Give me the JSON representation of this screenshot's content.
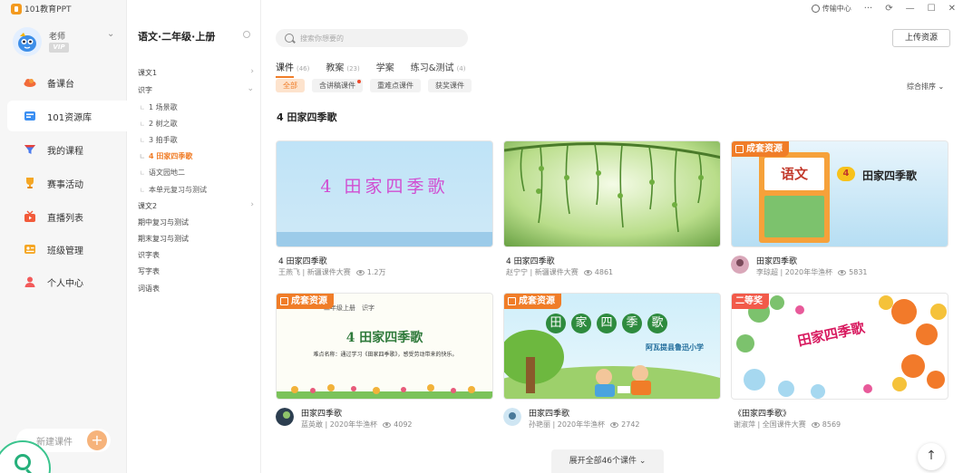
{
  "app": {
    "brand": "101教育PPT"
  },
  "titlebar": {
    "transfer": "传输中心",
    "more": "···",
    "sync": "⟳",
    "minimize": "—",
    "maximize": "☐",
    "close": "✕"
  },
  "user": {
    "name": "老师",
    "vip": "VIP",
    "chevron": "⌄"
  },
  "nav": {
    "items": [
      {
        "label": "备课台",
        "icon": "cloud-icon",
        "color": "#f26b3a"
      },
      {
        "label": "101资源库",
        "icon": "library-icon",
        "color": "#3a8ef2"
      },
      {
        "label": "我的课程",
        "icon": "funnel-icon",
        "color": "#4a7bef"
      },
      {
        "label": "赛事活动",
        "icon": "trophy-icon",
        "color": "#f5a623"
      },
      {
        "label": "直播列表",
        "icon": "live-tv-icon",
        "color": "#f25a3a"
      },
      {
        "label": "班级管理",
        "icon": "class-icon",
        "color": "#f5a623"
      },
      {
        "label": "个人中心",
        "icon": "person-icon",
        "color": "#f25a5a"
      }
    ],
    "new_course": "新建课件",
    "plus": "+"
  },
  "tree": {
    "book_title": "语文·二年级·上册",
    "rows": [
      {
        "label": "课文1",
        "chevron": "›"
      },
      {
        "label": "识字",
        "chevron": "⌄"
      },
      {
        "label": "1 场景歌",
        "bullet": "∟"
      },
      {
        "label": "2 树之歌",
        "bullet": "∟"
      },
      {
        "label": "3 拍手歌",
        "bullet": "∟"
      },
      {
        "label": "4 田家四季歌",
        "bullet": "∟"
      },
      {
        "label": "语文园地二",
        "bullet": "∟"
      },
      {
        "label": "本单元复习与测试",
        "bullet": "∟"
      },
      {
        "label": "课文2",
        "chevron": "›"
      },
      {
        "label": "期中复习与测试"
      },
      {
        "label": "期末复习与测试"
      },
      {
        "label": "识字表"
      },
      {
        "label": "写字表"
      },
      {
        "label": "词语表"
      }
    ]
  },
  "main": {
    "search_placeholder": "搜索你想要的",
    "upload": "上传资源",
    "tabs": [
      {
        "label": "课件",
        "count": "(46)"
      },
      {
        "label": "教案",
        "count": "(23)"
      },
      {
        "label": "学案",
        "count": ""
      },
      {
        "label": "练习&测试",
        "count": "(4)"
      }
    ],
    "chips": [
      "全部",
      "含讲稿课件",
      "重难点课件",
      "获奖课件"
    ],
    "sort": "综合排序 ⌄",
    "section_title": "4 田家四季歌",
    "expand": "展开全部46个课件 ⌄",
    "back_top": "↑"
  },
  "cards": [
    {
      "title": "4 田家四季歌",
      "meta": "王燕飞 | 新疆课件大赛",
      "views": "1.2万"
    },
    {
      "title": "4 田家四季歌",
      "meta": "赵宁宁 | 新疆课件大赛",
      "views": "4861"
    },
    {
      "title": "田家四季歌",
      "meta": "李琼超 | 2020年华渔杯",
      "views": "5831",
      "badge": "成套资源",
      "cover_small": "语文",
      "cover_num": "4",
      "cover_title": "田家四季歌"
    },
    {
      "title": "田家四季歌",
      "meta": "蓝英敢 | 2020年华渔杯",
      "views": "4092",
      "badge": "成套资源",
      "cover_small": "二年级上册　识字",
      "cover_title": "4 田家四季歌",
      "cover_note": "难点名称：通过学习《田家四季歌》，感受劳动带来的快乐。"
    },
    {
      "title": "田家四季歌",
      "meta": "孙艳丽 | 2020年华渔杯",
      "views": "2742",
      "badge": "成套资源",
      "cover_chars": [
        "田",
        "家",
        "四",
        "季",
        "歌"
      ],
      "cover_school": "阿瓦提县鲁迅小学"
    },
    {
      "title": "《田家四季歌》",
      "meta": "谢淑萍 | 全国课件大赛",
      "views": "8569",
      "badge": "二等奖",
      "cover_title": "田家四季歌"
    }
  ]
}
